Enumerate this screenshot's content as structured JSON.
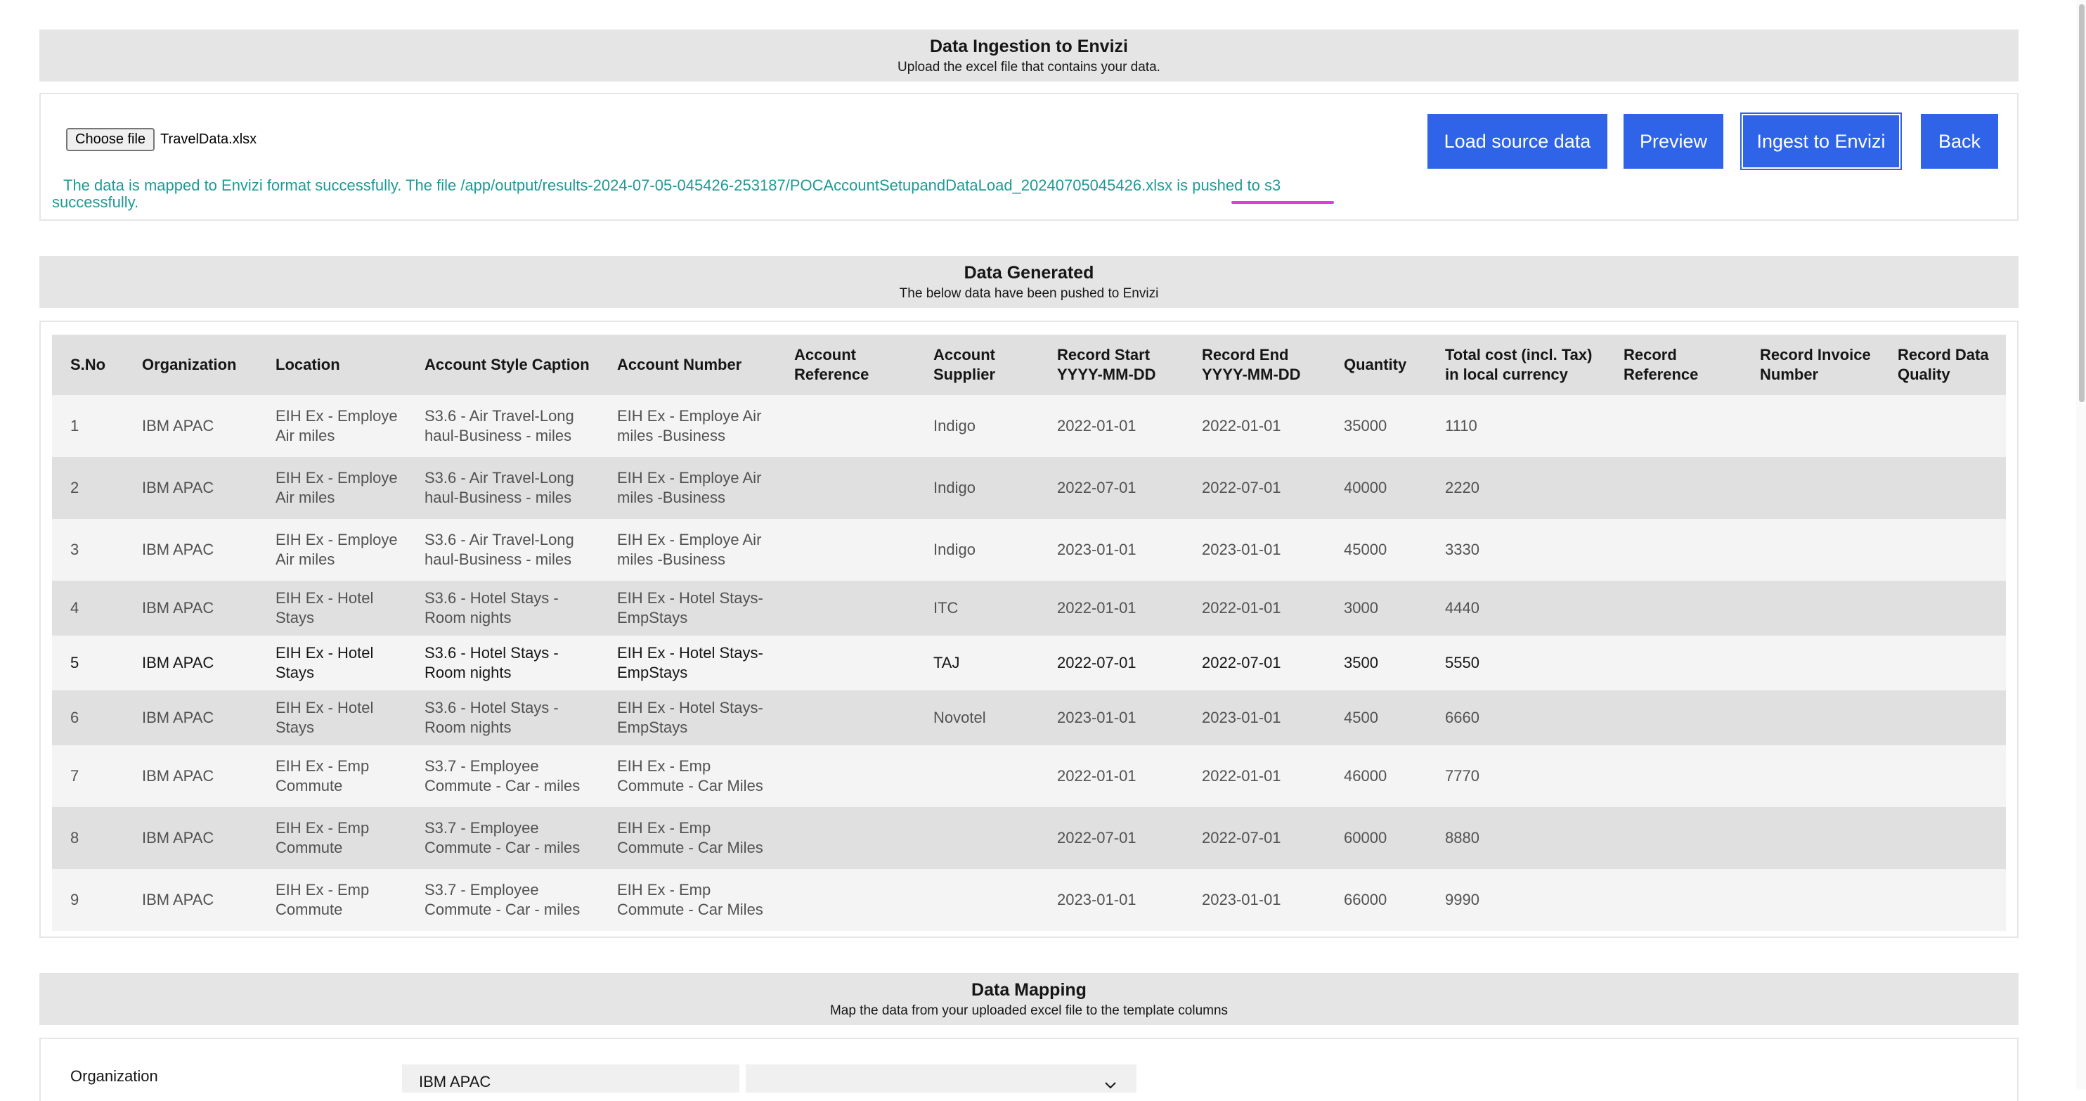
{
  "ingestion": {
    "title": "Data Ingestion to Envizi",
    "subtitle": "Upload the excel file that contains your data.",
    "choose_file_label": "Choose file",
    "file_name": "TravelData.xlsx",
    "buttons": {
      "load": "Load source data",
      "preview": "Preview",
      "ingest": "Ingest to Envizi",
      "back": "Back"
    },
    "status_message": "The data is mapped to Envizi format successfully. The file /app/output/results-2024-07-05-045426-253187/POCAccountSetupandDataLoad_20240705045426.xlsx is pushed to s3 successfully."
  },
  "generated": {
    "title": "Data Generated",
    "subtitle": "The below data have been pushed to Envizi",
    "columns": [
      "S.No",
      "Organization",
      "Location",
      "Account Style Caption",
      "Account Number",
      "Account Reference",
      "Account Supplier",
      "Record Start YYYY-MM-DD",
      "Record End YYYY-MM-DD",
      "Quantity",
      "Total cost (incl. Tax) in local currency",
      "Record Reference",
      "Record Invoice Number",
      "Record Data Quality"
    ],
    "rows": [
      [
        "1",
        "IBM APAC",
        "EIH Ex - Employe Air miles",
        "S3.6 - Air Travel-Long haul-Business - miles",
        "EIH Ex - Employe Air miles -Business",
        "",
        "Indigo",
        "2022-01-01",
        "2022-01-01",
        "35000",
        "1110",
        "",
        "",
        ""
      ],
      [
        "2",
        "IBM APAC",
        "EIH Ex - Employe Air miles",
        "S3.6 - Air Travel-Long haul-Business - miles",
        "EIH Ex - Employe Air miles -Business",
        "",
        "Indigo",
        "2022-07-01",
        "2022-07-01",
        "40000",
        "2220",
        "",
        "",
        ""
      ],
      [
        "3",
        "IBM APAC",
        "EIH Ex - Employe Air miles",
        "S3.6 - Air Travel-Long haul-Business - miles",
        "EIH Ex - Employe Air miles -Business",
        "",
        "Indigo",
        "2023-01-01",
        "2023-01-01",
        "45000",
        "3330",
        "",
        "",
        ""
      ],
      [
        "4",
        "IBM APAC",
        "EIH Ex - Hotel Stays",
        "S3.6 - Hotel Stays - Room nights",
        "EIH Ex - Hotel Stays-EmpStays",
        "",
        "ITC",
        "2022-01-01",
        "2022-01-01",
        "3000",
        "4440",
        "",
        "",
        ""
      ],
      [
        "5",
        "IBM APAC",
        "EIH Ex - Hotel Stays",
        "S3.6 - Hotel Stays - Room nights",
        "EIH Ex - Hotel Stays-EmpStays",
        "",
        "TAJ",
        "2022-07-01",
        "2022-07-01",
        "3500",
        "5550",
        "",
        "",
        ""
      ],
      [
        "6",
        "IBM APAC",
        "EIH Ex - Hotel Stays",
        "S3.6 - Hotel Stays - Room nights",
        "EIH Ex - Hotel Stays-EmpStays",
        "",
        "Novotel",
        "2023-01-01",
        "2023-01-01",
        "4500",
        "6660",
        "",
        "",
        ""
      ],
      [
        "7",
        "IBM APAC",
        "EIH Ex - Emp Commute",
        "S3.7 - Employee Commute - Car - miles",
        "EIH Ex - Emp Commute - Car Miles",
        "",
        "",
        "2022-01-01",
        "2022-01-01",
        "46000",
        "7770",
        "",
        "",
        ""
      ],
      [
        "8",
        "IBM APAC",
        "EIH Ex - Emp Commute",
        "S3.7 - Employee Commute - Car - miles",
        "EIH Ex - Emp Commute - Car Miles",
        "",
        "",
        "2022-07-01",
        "2022-07-01",
        "60000",
        "8880",
        "",
        "",
        ""
      ],
      [
        "9",
        "IBM APAC",
        "EIH Ex - Emp Commute",
        "S3.7 - Employee Commute - Car - miles",
        "EIH Ex - Emp Commute - Car Miles",
        "",
        "",
        "2023-01-01",
        "2023-01-01",
        "66000",
        "9990",
        "",
        "",
        ""
      ]
    ]
  },
  "mapping": {
    "title": "Data Mapping",
    "subtitle": "Map the data from your uploaded excel file to the template columns",
    "rows": [
      {
        "label": "Organization",
        "value": "IBM APAC",
        "selected": "",
        "icon": "chevron-down-icon"
      }
    ]
  }
}
